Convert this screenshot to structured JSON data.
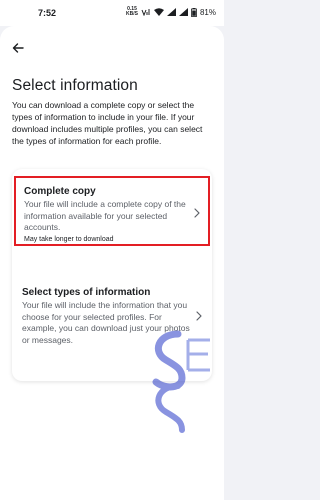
{
  "status_bar": {
    "time": "7:52",
    "network_top": "0.15",
    "network_bottom": "KB/S",
    "battery": "81%"
  },
  "header": {
    "back_icon": "arrow-left-icon"
  },
  "page": {
    "title": "Select information",
    "description": "You can download a complete copy or select the types of information to include in your file. If your download includes multiple profiles, you can select the types of information for each profile."
  },
  "options": [
    {
      "title": "Complete copy",
      "description": "Your file will include a complete copy of the information available for your selected accounts.",
      "note": "May take longer to download",
      "highlight_color": "#e31e24"
    },
    {
      "title": "Select types of information",
      "description": "Your file will include the information that you choose for your selected profiles. For example, you can download just your photos or messages."
    }
  ]
}
